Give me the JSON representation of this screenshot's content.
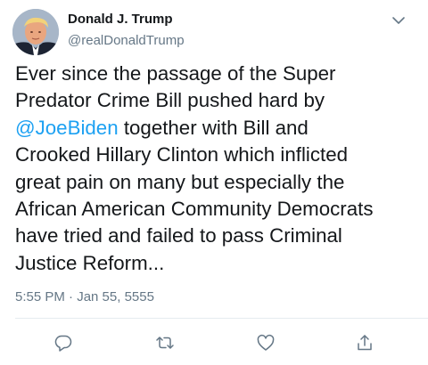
{
  "author": {
    "display_name": "Donald J. Trump",
    "handle": "@realDonaldTrump"
  },
  "tweet": {
    "line1": "Ever since the passage of the Super",
    "line2": "Predator Crime Bill pushed hard by",
    "mention": "@JoeBiden",
    "line3_rest": " together with Bill and",
    "line4": "Crooked Hillary Clinton which inflicted",
    "line5": "great pain on many but especially the",
    "line6": "African American Community Democrats",
    "line7": "have tried and failed to pass Criminal",
    "line8": "Justice Reform..."
  },
  "timestamp": "5:55 PM · Jan 55, 5555",
  "icons": {
    "menu": "chevron-down-icon",
    "reply": "reply-icon",
    "retweet": "retweet-icon",
    "like": "heart-icon",
    "share": "share-icon"
  },
  "colors": {
    "text": "#14171a",
    "secondary": "#657786",
    "link": "#1da1f2",
    "divider": "#e6ecf0"
  }
}
